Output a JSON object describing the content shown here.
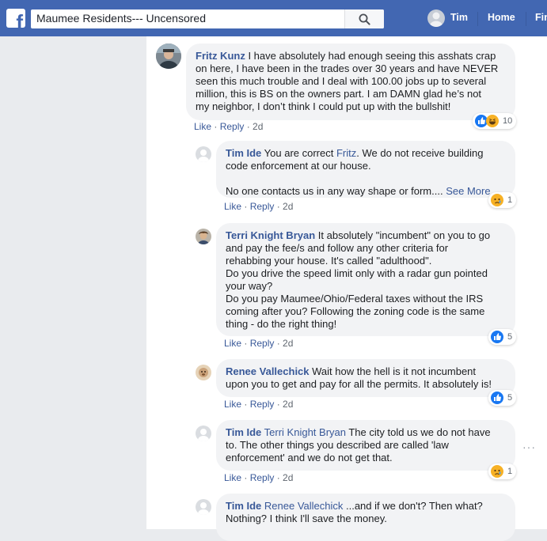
{
  "topbar": {
    "search_value": "Maumee Residents--- Uncensored",
    "user_name": "Tim",
    "home_label": "Home",
    "find_label": "Fin"
  },
  "comments": [
    {
      "author": "Fritz Kunz",
      "lines": [
        " I have absolutely had enough seeing this asshats crap",
        "on here, I have been in the trades over 30 years and have NEVER",
        "seen this much trouble and I deal with 100.00 jobs up to several",
        "million, this is BS on the owners part. I am DAMN glad he’s not",
        "my neighbor, I don’t think I could put up with the bullshit!"
      ],
      "like": "Like",
      "reply": "Reply",
      "age": "2d",
      "reactions": [
        "like",
        "haha"
      ],
      "reaction_count": "10"
    },
    {
      "author": "Tim Ide",
      "first_line": " You are correct ",
      "mention": "Fritz",
      "first_line_end": ". We do not receive building",
      "lines": [
        "code enforcement at our house.",
        "",
        "No one contacts us in any way shape or form.... "
      ],
      "see_more": "See More",
      "like": "Like",
      "reply": "Reply",
      "age": "2d",
      "reactions": [
        "sad"
      ],
      "reaction_count": "1"
    },
    {
      "author": "Terri Knight Bryan",
      "lines": [
        " It absolutely \"incumbent\" on you to go",
        "and pay the fee/s and follow any other criteria for",
        "rehabbing your house. It's called \"adulthood\".",
        "Do you drive the speed limit only with a radar gun pointed",
        "your way?",
        "Do you pay Maumee/Ohio/Federal taxes without the IRS",
        "coming after you? Following the zoning code is the same",
        "thing - do the right thing!"
      ],
      "like": "Like",
      "reply": "Reply",
      "age": "2d",
      "reactions": [
        "like"
      ],
      "reaction_count": "5"
    },
    {
      "author": "Renee Vallechick",
      "lines": [
        " Wait how the hell is it not incumbent",
        "upon you to get and pay for all the permits. It absolutely is!"
      ],
      "like": "Like",
      "reply": "Reply",
      "age": "2d",
      "reactions": [
        "like"
      ],
      "reaction_count": "5"
    },
    {
      "author": "Tim Ide",
      "mention": " Terri Knight Bryan",
      "lines": [
        " The city told us we do not have",
        "to. The other things you described are called 'law",
        "enforcement' and we do not get that."
      ],
      "like": "Like",
      "reply": "Reply",
      "age": "2d",
      "reactions": [
        "sad"
      ],
      "reaction_count": "1"
    },
    {
      "author": "Tim Ide",
      "mention": " Renee Vallechick",
      "lines": [
        " ...and if we don't? Then what?",
        "Nothing? I think I'll save the money."
      ]
    }
  ],
  "more_options": "···",
  "colors": {
    "brand": "#4267b2",
    "link": "#385898",
    "bubble": "#f2f3f5",
    "page_bg": "#e9ebee"
  },
  "icons": [
    "facebook-logo-icon",
    "search-icon",
    "like-reaction-icon",
    "haha-reaction-icon",
    "sad-reaction-icon"
  ]
}
